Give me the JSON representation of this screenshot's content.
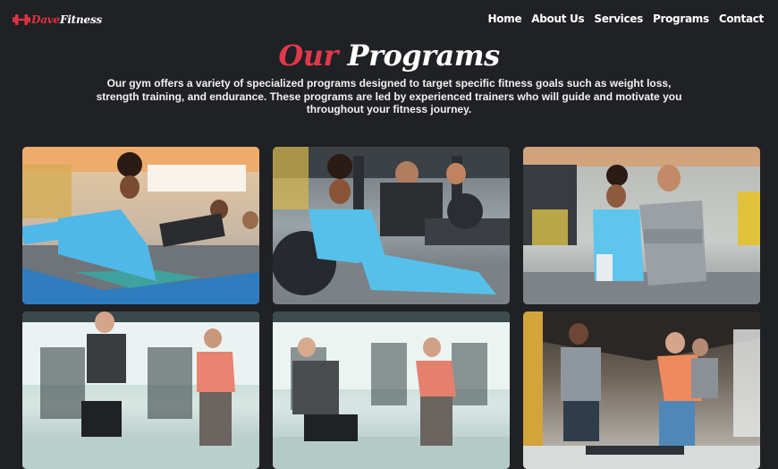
{
  "brand": {
    "logo_part1": "Dave",
    "logo_part2": "Fitness",
    "icon": "dumbbell-icon"
  },
  "nav": {
    "items": [
      "Home",
      "About Us",
      "Services",
      "Programs",
      "Contact"
    ]
  },
  "section": {
    "title_part1": "Our",
    "title_part2": "Programs",
    "description": "Our gym offers a variety of specialized programs designed to target specific fitness goals such as weight loss, strength training, and endurance. These programs are led by experienced trainers who will guide and motivate you throughout your fitness journey."
  },
  "colors": {
    "background": "#202124",
    "accent": "#e0394a",
    "text": "#ffffff"
  },
  "programs": [
    {
      "image": "group-plank-photo"
    },
    {
      "image": "stability-ball-class-photo"
    },
    {
      "image": "trainer-duo-photo"
    },
    {
      "image": "lunge-training-photo"
    },
    {
      "image": "squat-class-photo"
    },
    {
      "image": "step-lunge-class-photo"
    }
  ]
}
